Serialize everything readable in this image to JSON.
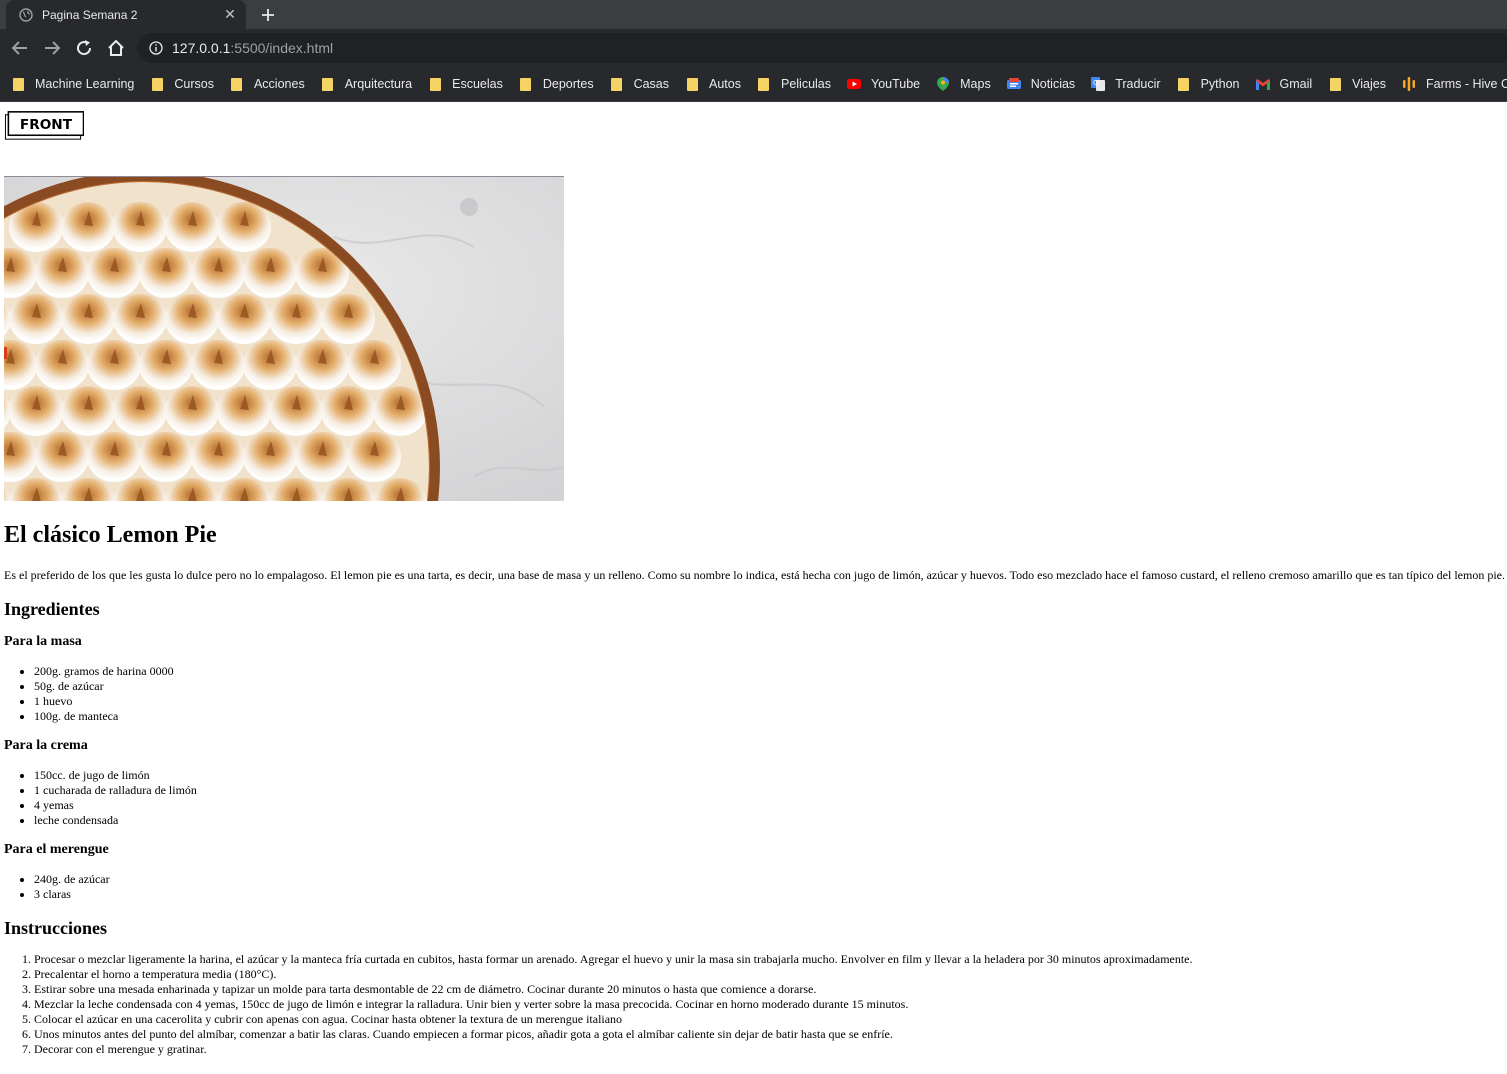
{
  "browser": {
    "tab_title": "Pagina Semana 2",
    "url_host": "127.0.0.1",
    "url_rest": ":5500/index.html",
    "bookmarks": [
      {
        "label": "Machine Learning",
        "icon": "folder-icon"
      },
      {
        "label": "Cursos",
        "icon": "folder-icon"
      },
      {
        "label": "Acciones",
        "icon": "folder-icon"
      },
      {
        "label": "Arquitectura",
        "icon": "folder-icon"
      },
      {
        "label": "Escuelas",
        "icon": "folder-icon"
      },
      {
        "label": "Deportes",
        "icon": "folder-icon"
      },
      {
        "label": "Casas",
        "icon": "folder-icon"
      },
      {
        "label": "Autos",
        "icon": "folder-icon"
      },
      {
        "label": "Peliculas",
        "icon": "folder-icon"
      },
      {
        "label": "YouTube",
        "icon": "youtube-icon"
      },
      {
        "label": "Maps",
        "icon": "maps-icon"
      },
      {
        "label": "Noticias",
        "icon": "news-icon"
      },
      {
        "label": "Traducir",
        "icon": "translate-icon"
      },
      {
        "label": "Python",
        "icon": "folder-icon"
      },
      {
        "label": "Gmail",
        "icon": "gmail-icon"
      },
      {
        "label": "Viajes",
        "icon": "folder-icon"
      },
      {
        "label": "Farms - Hive OS",
        "icon": "hive-icon"
      }
    ]
  },
  "page": {
    "logo_text": "FRONT",
    "title": "El clásico Lemon Pie",
    "intro": "Es el preferido de los que les gusta lo dulce pero no lo empalagoso. El lemon pie es una tarta, es decir, una base de masa y un relleno. Como su nombre lo indica, está hecha con jugo de limón, azúcar y huevos. Todo eso mezclado hace el famoso custard, el relleno cremoso amarillo que es tan típico del lemon pie.",
    "ingredients_heading": "Ingredientes",
    "masa": {
      "heading": "Para la masa",
      "items": [
        "200g. gramos de harina 0000",
        "50g. de azúcar",
        "1 huevo",
        "100g. de manteca"
      ]
    },
    "crema": {
      "heading": "Para la crema",
      "items": [
        "150cc. de jugo de limón",
        "1 cucharada de ralladura de limón",
        "4 yemas",
        "leche condensada"
      ]
    },
    "merengue": {
      "heading": "Para el merengue",
      "items": [
        "240g. de azúcar",
        "3 claras"
      ]
    },
    "instructions_heading": "Instrucciones",
    "instructions": [
      "Procesar o mezclar ligeramente la harina, el azúcar y la manteca fría curtada en cubitos, hasta formar un arenado. Agregar el huevo y unir la masa sin trabajarla mucho. Envolver en film y llevar a la heladera por 30 minutos aproximadamente.",
      "Precalentar el horno a temperatura media (180°C).",
      "Estirar sobre una mesada enharinada y tapizar un molde para tarta desmontable de 22 cm de diámetro. Cocinar durante 20 minutos o hasta que comience a dorarse.",
      "Mezclar la leche condensada con 4 yemas, 150cc de jugo de limón e integrar la ralladura. Unir bien y verter sobre la masa precocida. Cocinar en horno moderado durante 15 minutos.",
      "Colocar el azúcar en una cacerolita y cubrir con apenas con agua. Cocinar hasta obtener la textura de un merengue italiano",
      "Unos minutos antes del punto del almíbar, comenzar a batir las claras. Cuando empiecen a formar picos, añadir gota a gota el almíbar caliente sin dejar de batir hasta que se enfríe.",
      "Decorar con el merengue y gratinar."
    ]
  }
}
